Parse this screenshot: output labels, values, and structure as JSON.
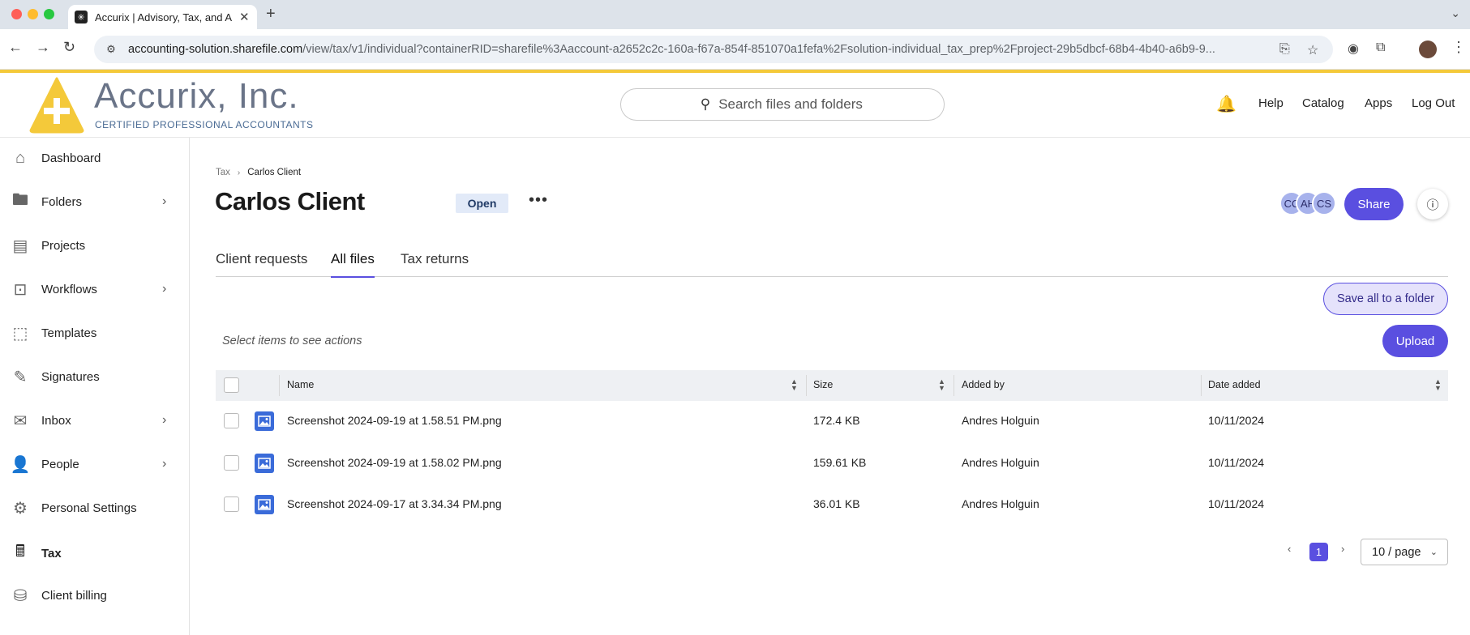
{
  "browser": {
    "tab_title": "Accurix | Advisory, Tax, and A",
    "url_host": "accounting-solution.sharefile.com",
    "url_path": "/view/tax/v1/individual?containerRID=sharefile%3Aaccount-a2652c2c-160a-f67a-854f-851070a1fefa%2Fsolution-individual_tax_prep%2Fproject-29b5dbcf-68b4-4b40-a6b9-9..."
  },
  "brand": {
    "name": "Accurix, Inc.",
    "tagline": "CERTIFIED PROFESSIONAL ACCOUNTANTS",
    "logo_color": "#f4c93a"
  },
  "header": {
    "search_placeholder": "Search files and folders",
    "nav": [
      "Help",
      "Catalog",
      "Apps",
      "Log Out"
    ]
  },
  "sidebar": {
    "items": [
      {
        "label": "Dashboard",
        "icon": "home-icon",
        "expandable": false
      },
      {
        "label": "Folders",
        "icon": "folder-icon",
        "expandable": true
      },
      {
        "label": "Projects",
        "icon": "projects-icon",
        "expandable": false
      },
      {
        "label": "Workflows",
        "icon": "workflows-icon",
        "expandable": true
      },
      {
        "label": "Templates",
        "icon": "templates-icon",
        "expandable": false
      },
      {
        "label": "Signatures",
        "icon": "pen-icon",
        "expandable": false
      },
      {
        "label": "Inbox",
        "icon": "mail-icon",
        "expandable": true
      },
      {
        "label": "People",
        "icon": "person-icon",
        "expandable": true
      },
      {
        "label": "Personal Settings",
        "icon": "gear-icon",
        "expandable": false
      },
      {
        "label": "Tax",
        "icon": "tax-icon",
        "expandable": false,
        "active": true
      },
      {
        "label": "Client billing",
        "icon": "coins-icon",
        "expandable": false
      }
    ]
  },
  "main": {
    "breadcrumb": [
      "Tax",
      "Carlos Client"
    ],
    "title": "Carlos Client",
    "status": "Open",
    "avatars": [
      "CC",
      "AH",
      "CS"
    ],
    "share_label": "Share",
    "tabs": [
      {
        "label": "Client requests",
        "active": false
      },
      {
        "label": "All files",
        "active": true
      },
      {
        "label": "Tax returns",
        "active": false
      }
    ],
    "save_all_label": "Save all to a folder",
    "select_hint": "Select items to see actions",
    "upload_label": "Upload",
    "accent_color": "#5a4fe0"
  },
  "table": {
    "columns": [
      "Name",
      "Size",
      "Added by",
      "Date added"
    ],
    "rows": [
      {
        "name": "Screenshot 2024-09-19 at 1.58.51 PM.png",
        "size": "172.4 KB",
        "added_by": "Andres Holguin",
        "date": "10/11/2024"
      },
      {
        "name": "Screenshot 2024-09-19 at 1.58.02 PM.png",
        "size": "159.61 KB",
        "added_by": "Andres Holguin",
        "date": "10/11/2024"
      },
      {
        "name": "Screenshot 2024-09-17 at 3.34.34 PM.png",
        "size": "36.01 KB",
        "added_by": "Andres Holguin",
        "date": "10/11/2024"
      }
    ]
  },
  "pagination": {
    "current_page": "1",
    "page_size": "10 / page"
  }
}
